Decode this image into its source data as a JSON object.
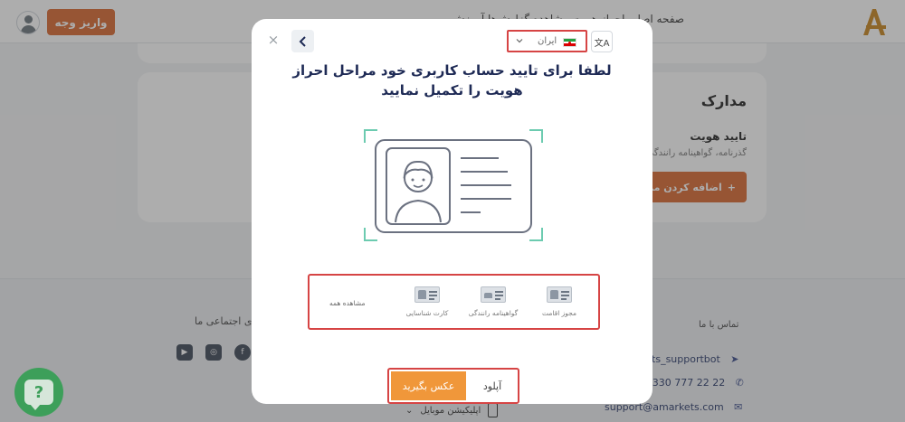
{
  "header": {
    "nav_text": "صفحه اصلی    احراز هویت    مشاهده گزارش‌ها    آموزش",
    "deposit_label": "واریز وجه",
    "logo": "A"
  },
  "documents": {
    "title": "مدارک",
    "verify_title": "تایید هویت",
    "verify_subtitle": "گذرنامه، گواهینامه رانندگی",
    "add_button": "اضافه کردن مدرک"
  },
  "footer": {
    "social_title": "شبکه‌های اجتماعی ما",
    "social_icons": [
      "youtube-icon",
      "instagram-icon",
      "facebook-icon"
    ],
    "contact_title": "تماس با ما",
    "telegram": "@AMarkets_supportbot",
    "phone": "+7 (495) 330 777 22 22",
    "email": "support@amarkets.com",
    "mobile_app": "اپلیکیشن موبایل"
  },
  "help": {
    "label": "?"
  },
  "modal": {
    "close": "×",
    "country": "ایران",
    "translate_label": "文A",
    "title": "لطفا برای تایید حساب کاربری خود مراحل احراز هویت را تکمیل نمایید",
    "doc_types": [
      {
        "label": "مجوز اقامت",
        "icon": "residence-permit-icon"
      },
      {
        "label": "گواهینامه رانندگی",
        "icon": "driving-license-icon"
      },
      {
        "label": "کارت شناسایی",
        "icon": "id-card-icon"
      }
    ],
    "view_all": "مشاهده همه",
    "take_photo": "عکس بگیرید",
    "upload": "آپلود"
  },
  "colors": {
    "accent": "#d9682f",
    "photo_button": "#f0973a",
    "highlight": "#d64444",
    "frame_green": "#6ccbb0",
    "help_green": "#3d9f5a"
  }
}
